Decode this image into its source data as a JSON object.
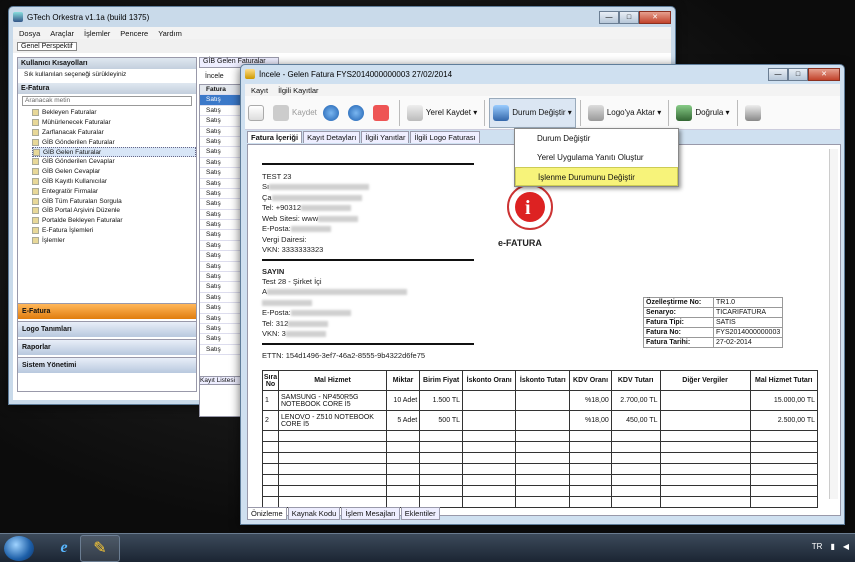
{
  "back_window": {
    "title": "GTech Orkestra v1.1a (build 1375)",
    "menu": [
      "Dosya",
      "Araçlar",
      "İşlemler",
      "Pencere",
      "Yardım"
    ],
    "perspective": "Genel Perspektif",
    "shortcuts_title": "Kullanıcı Kısayolları",
    "shortcuts_hint": "Sık kullanılan seçeneği sürükleyiniz",
    "efatura_header": "E-Fatura",
    "search_placeholder": "Aranacak metin",
    "tree": [
      "Bekleyen Faturalar",
      "Mühürlenecek Faturalar",
      "Zarflanacak Faturalar",
      "GİB Gönderilen Faturalar",
      "GİB Gelen Faturalar",
      "GİB Gönderilen Cevaplar",
      "GİB Gelen Cevaplar",
      "GİB Kayıtlı Kullanıcılar",
      "Entegratör Firmalar",
      "GİB Tüm Faturaları Sorgula",
      "GİB Portal Arşivini Düzenle",
      "Portalde Bekleyen Faturalar",
      "E-Fatura İşlemleri",
      "İşlemler"
    ],
    "nav": [
      "E-Fatura",
      "Logo Tanımları",
      "Raporlar",
      "Sistem Yönetimi"
    ],
    "tab": "GİB Gelen Faturalar",
    "list_header": "Fatura",
    "list_items": [
      "Satış",
      "Satış",
      "Satış",
      "Satış",
      "Satış",
      "Satış",
      "Satış",
      "Satış",
      "Satış",
      "Satış",
      "Satış",
      "Satış",
      "Satış",
      "Satış",
      "Satış",
      "Satış",
      "Satış",
      "Satış",
      "Satış",
      "Satış",
      "Satış",
      "Satış",
      "Satış",
      "Satış",
      "Satış"
    ],
    "list_footer": "Kayıt Listesi",
    "toolbar_label": "İncele"
  },
  "front_window": {
    "title": "İncele - Gelen Fatura FYS2014000000003 27/02/2014",
    "menu": [
      "Kayıt",
      "İlgili Kayıtlar"
    ],
    "toolbar": {
      "save": "Kaydet",
      "local_save": "Yerel Kaydet",
      "status_change": "Durum Değiştir",
      "logo_transfer": "Logo'ya Aktar",
      "verify": "Doğrula"
    },
    "tabs": [
      "Fatura İçeriği",
      "Kayıt Detayları",
      "İlgili Yanıtlar",
      "İlgili Logo Faturası"
    ],
    "bottom_tabs": [
      "Önizleme",
      "Kaynak Kodu",
      "İşlem Mesajları",
      "Eklentiler"
    ],
    "dropdown": [
      "Durum Değiştir",
      "Yerel Uygulama Yanıtı Oluştur",
      "İşlenme Durumunu Değiştir"
    ]
  },
  "invoice": {
    "seller_name": "TEST 23",
    "seller_lines": [
      "Sı",
      "Ça",
      "Tel: +90312",
      "Web Sitesi: www",
      "E-Posta:",
      "Vergi Dairesi:",
      "VKN: 3333333323"
    ],
    "buyer_title": "SAYIN",
    "buyer_name": "Test 28 - Şirket İçi",
    "buyer_lines": [
      "A",
      "",
      "E-Posta:",
      "Tel: 312",
      "VKN: 3"
    ],
    "ettn": "ETTN: 154d1496-3ef7-46a2-8555-9b4322d6fe75",
    "logo_text": "e-FATURA",
    "info": [
      [
        "Özelleştirme No:",
        "TR1.0"
      ],
      [
        "Senaryo:",
        "TICARIFATURA"
      ],
      [
        "Fatura Tipi:",
        "SATIS"
      ],
      [
        "Fatura No:",
        "FYS2014000000003"
      ],
      [
        "Fatura Tarihi:",
        "27-02-2014"
      ]
    ],
    "columns": [
      "Sıra No",
      "Mal Hizmet",
      "Miktar",
      "Birim Fiyat",
      "İskonto Oranı",
      "İskonto Tutarı",
      "KDV Oranı",
      "KDV Tutarı",
      "Diğer Vergiler",
      "Mal Hizmet Tutarı"
    ],
    "rows": [
      [
        "1",
        "SAMSUNG - NP450R5G NOTEBOOK CORE İ5",
        "10 Adet",
        "1.500 TL",
        "",
        "",
        "%18,00",
        "2.700,00 TL",
        "",
        "15.000,00 TL"
      ],
      [
        "2",
        "LENOVO - Z510 NOTEBOOK CORE İ5",
        "5 Adet",
        "500 TL",
        "",
        "",
        "%18,00",
        "450,00 TL",
        "",
        "2.500,00 TL"
      ]
    ]
  },
  "taskbar": {
    "lang": "TR"
  }
}
